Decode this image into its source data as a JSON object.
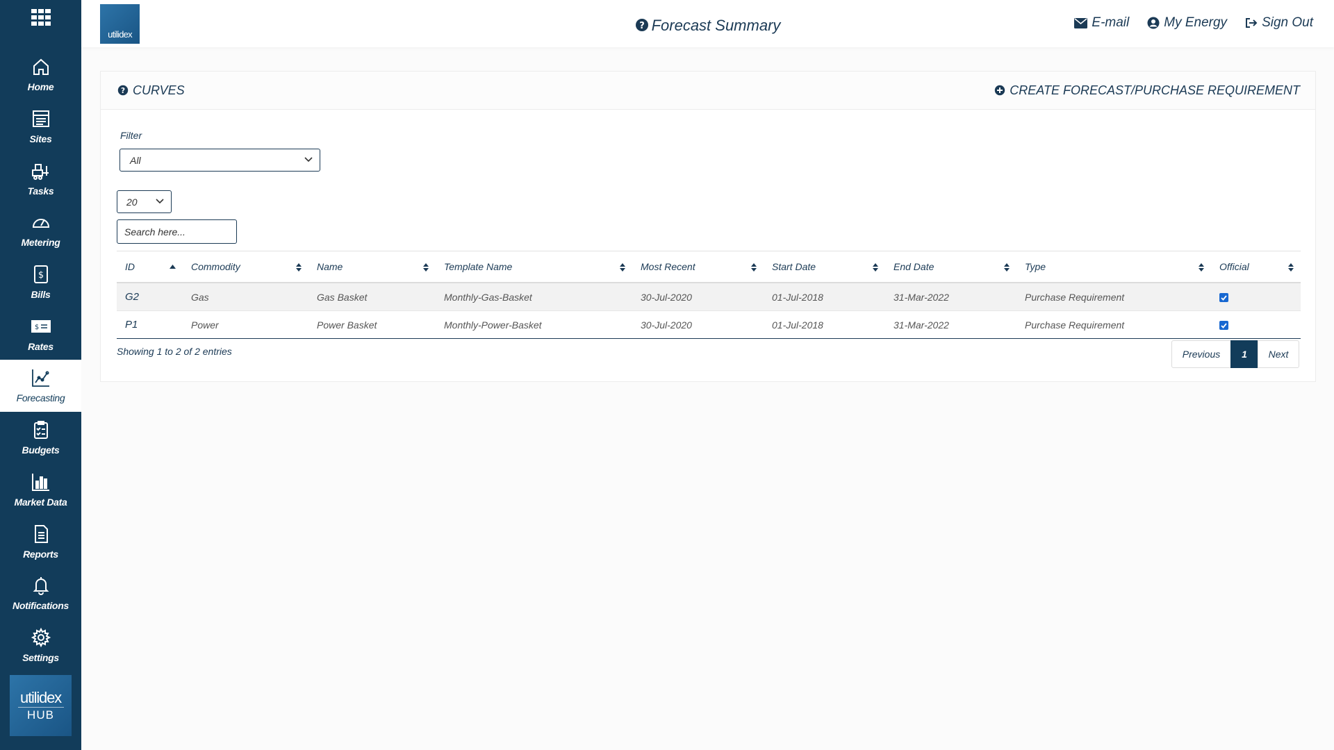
{
  "sidebar": {
    "items": [
      {
        "key": "home",
        "label": "Home",
        "icon": "home-icon"
      },
      {
        "key": "sites",
        "label": "Sites",
        "icon": "sites-icon"
      },
      {
        "key": "tasks",
        "label": "Tasks",
        "icon": "tasks-icon"
      },
      {
        "key": "metering",
        "label": "Metering",
        "icon": "gauge-icon"
      },
      {
        "key": "bills",
        "label": "Bills",
        "icon": "bill-icon"
      },
      {
        "key": "rates",
        "label": "Rates",
        "icon": "rates-icon"
      },
      {
        "key": "forecasting",
        "label": "Forecasting",
        "icon": "chart-line-icon",
        "active": true
      },
      {
        "key": "budgets",
        "label": "Budgets",
        "icon": "clipboard-icon"
      },
      {
        "key": "market-data",
        "label": "Market Data",
        "icon": "bar-chart-icon"
      },
      {
        "key": "reports",
        "label": "Reports",
        "icon": "document-icon"
      },
      {
        "key": "notifications",
        "label": "Notifications",
        "icon": "bell-icon"
      },
      {
        "key": "settings",
        "label": "Settings",
        "icon": "gear-icon"
      }
    ],
    "hub_logo": {
      "word": "utilidex",
      "sub": "HUB"
    }
  },
  "header": {
    "logo_text": "utilidex",
    "title": "Forecast Summary",
    "links": [
      {
        "label": "E-mail",
        "icon": "envelope-icon"
      },
      {
        "label": "My Energy",
        "icon": "user-circle-icon"
      },
      {
        "label": "Sign Out",
        "icon": "sign-out-icon"
      }
    ]
  },
  "panel": {
    "title": "CURVES",
    "create_label": "CREATE FORECAST/PURCHASE REQUIREMENT",
    "filter_label": "Filter",
    "filter_value": "All",
    "page_length": "20",
    "search_placeholder": "Search here..."
  },
  "table": {
    "columns": [
      "ID",
      "Commodity",
      "Name",
      "Template Name",
      "Most Recent",
      "Start Date",
      "End Date",
      "Type",
      "Official"
    ],
    "rows": [
      {
        "id": "G2",
        "commodity": "Gas",
        "name": "Gas Basket",
        "template": "Monthly-Gas-Basket",
        "most_recent": "30-Jul-2020",
        "start": "01-Jul-2018",
        "end": "31-Mar-2022",
        "type": "Purchase Requirement",
        "official": true
      },
      {
        "id": "P1",
        "commodity": "Power",
        "name": "Power Basket",
        "template": "Monthly-Power-Basket",
        "most_recent": "30-Jul-2020",
        "start": "01-Jul-2018",
        "end": "31-Mar-2022",
        "type": "Purchase Requirement",
        "official": true
      }
    ],
    "info": "Showing 1 to 2 of 2 entries"
  },
  "pagination": {
    "previous": "Previous",
    "current": "1",
    "next": "Next"
  },
  "colors": {
    "sidebar": "#123c5a",
    "accent": "#1868d1",
    "text": "#1b3a55"
  }
}
